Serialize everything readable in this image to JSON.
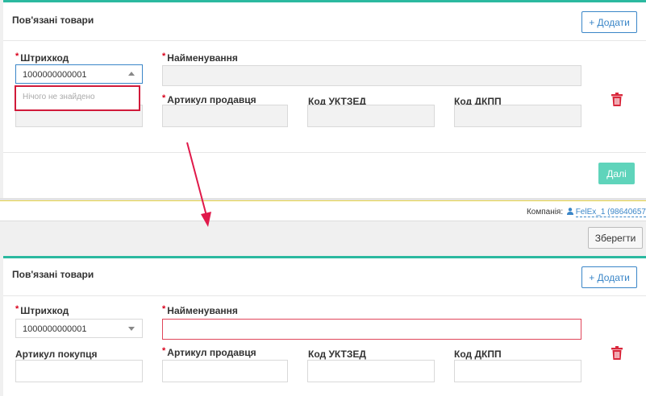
{
  "section_title": "Пов'язані товари",
  "add_label": "+ Додати",
  "next_label": "Далі",
  "save_label": "Зберегти",
  "company_label": "Компанія:",
  "company_value": "FelEx_1 (98640657",
  "labels": {
    "barcode": "Штрихкод",
    "name": "Найменування",
    "buyer_sku": "Артикул покупця",
    "seller_sku": "Артикул продавця",
    "uktzed": "Код УКТЗЕД",
    "dkpp": "Код ДКПП"
  },
  "barcode_value": "1000000000001",
  "dropdown_empty": "Нічого не знайдено",
  "colors": {
    "accent": "#2bb9a0",
    "link": "#3a86c8",
    "error": "#d11a3a",
    "next_btn": "#5fd4bb"
  }
}
